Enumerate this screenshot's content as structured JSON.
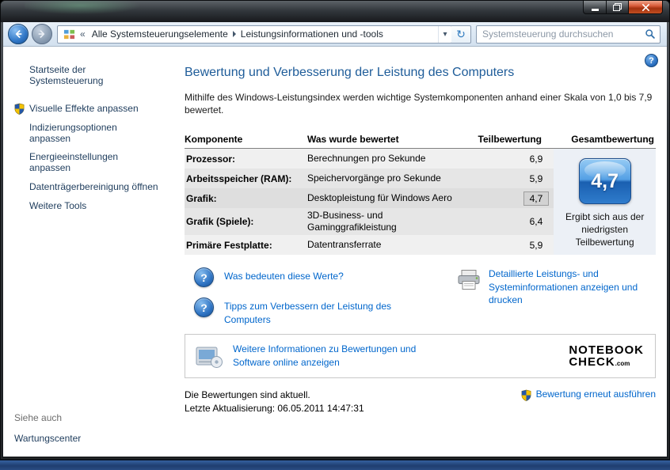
{
  "navbar": {
    "breadcrumb": {
      "overflow": "«",
      "segments": [
        "Alle Systemsteuerungselemente",
        "Leistungsinformationen und -tools"
      ]
    },
    "search": {
      "placeholder": "Systemsteuerung durchsuchen"
    }
  },
  "icons": {
    "help": "?",
    "dropdown": "▾",
    "refresh": "↻"
  },
  "sidebar": {
    "home": "Startseite der Systemsteuerung",
    "tasks": [
      {
        "label": "Visuelle Effekte anpassen",
        "shield": true
      },
      {
        "label": "Indizierungsoptionen anpassen"
      },
      {
        "label": "Energieeinstellungen anpassen"
      },
      {
        "label": "Datenträgerbereinigung öffnen"
      },
      {
        "label": "Weitere Tools"
      }
    ],
    "see_also": {
      "header": "Siehe auch",
      "items": [
        "Wartungscenter"
      ]
    }
  },
  "main": {
    "title": "Bewertung und Verbesserung der Leistung des Computers",
    "intro": "Mithilfe des Windows-Leistungsindex werden wichtige Systemkomponenten anhand einer Skala von 1,0 bis 7,9 bewertet.",
    "table": {
      "headers": {
        "component": "Komponente",
        "assessed": "Was wurde bewertet",
        "subscore": "Teilbewertung",
        "total": "Gesamtbewertung"
      },
      "rows": [
        {
          "component": "Prozessor:",
          "assessed": "Berechnungen pro Sekunde",
          "score": "6,9"
        },
        {
          "component": "Arbeitsspeicher (RAM):",
          "assessed": "Speichervorgänge pro Sekunde",
          "score": "5,9"
        },
        {
          "component": "Grafik:",
          "assessed": "Desktopleistung für Windows Aero",
          "score": "4,7"
        },
        {
          "component": "Grafik (Spiele):",
          "assessed": "3D-Business- und Gaminggrafikleistung",
          "score": "6,4"
        },
        {
          "component": "Primäre Festplatte:",
          "assessed": "Datentransferrate",
          "score": "5,9"
        }
      ],
      "base_score": {
        "value": "4,7",
        "caption": "Ergibt sich aus der niedrigsten Teilbewertung"
      }
    },
    "help_links": [
      "Was bedeuten diese Werte?",
      "Tipps zum Verbessern der Leistung des Computers"
    ],
    "print_link": "Detaillierte Leistungs- und Systeminformationen anzeigen und drucken",
    "online_box": {
      "link": "Weitere Informationen zu Bewertungen und Software online anzeigen",
      "logo": {
        "line1": "NOTEBOOK",
        "line2": "CHECK",
        "suffix": ".com"
      }
    },
    "status": {
      "line1": "Die Bewertungen sind aktuell.",
      "line2": "Letzte Aktualisierung: 06.05.2011 14:47:31",
      "rerun": "Bewertung erneut ausführen"
    }
  },
  "colors": {
    "link_blue": "#0066cc",
    "heading_blue": "#1e5c99",
    "badge_blue": "#2f7ccc",
    "taskbar_blue": "#2a4c82"
  }
}
